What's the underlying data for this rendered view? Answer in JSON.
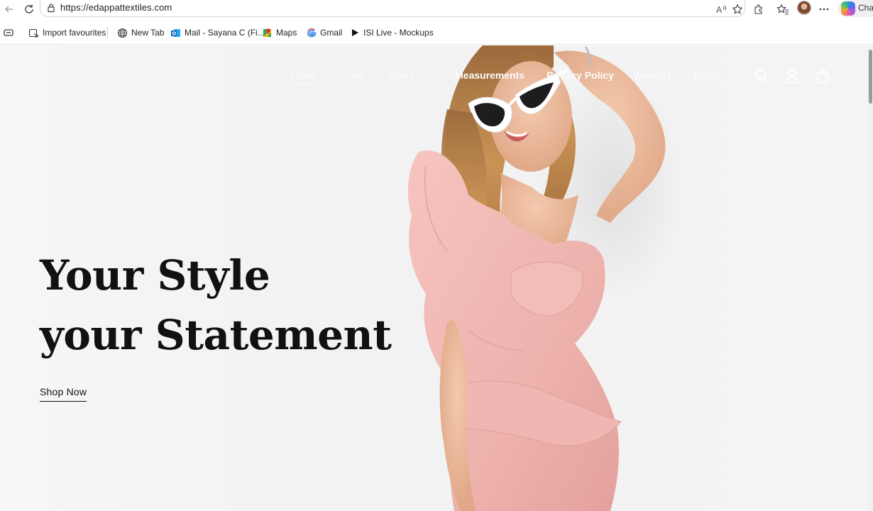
{
  "browser": {
    "url": "https://edappattextiles.com",
    "copilot_label": "Chat",
    "icons": [
      "back-icon",
      "refresh-icon",
      "lock-icon",
      "read-aloud-icon",
      "favorite-star-icon",
      "extensions-icon",
      "favorites-icon",
      "profile-avatar",
      "more-icon",
      "copilot-icon"
    ]
  },
  "bookmarks": [
    {
      "label": "Import favourites",
      "icon": "import-favourites-icon"
    },
    {
      "label": "New Tab",
      "icon": "globe-icon"
    },
    {
      "label": "Mail - Sayana C (Fi...",
      "icon": "outlook-icon"
    },
    {
      "label": "Maps",
      "icon": "maps-icon"
    },
    {
      "label": "Gmail",
      "icon": "google-icon"
    },
    {
      "label": "ISI Live - Mockups",
      "icon": "play-icon"
    }
  ],
  "site": {
    "nav": [
      {
        "label": "Home"
      },
      {
        "label": "Shop"
      },
      {
        "label": "About Us"
      },
      {
        "label": "Measurements"
      },
      {
        "label": "Privacy Policy"
      },
      {
        "label": "Wishlist"
      },
      {
        "label": "Login"
      }
    ],
    "hero": {
      "headline_line1": "Your Style",
      "headline_line2": "your Statement",
      "cta": "Shop Now"
    }
  }
}
